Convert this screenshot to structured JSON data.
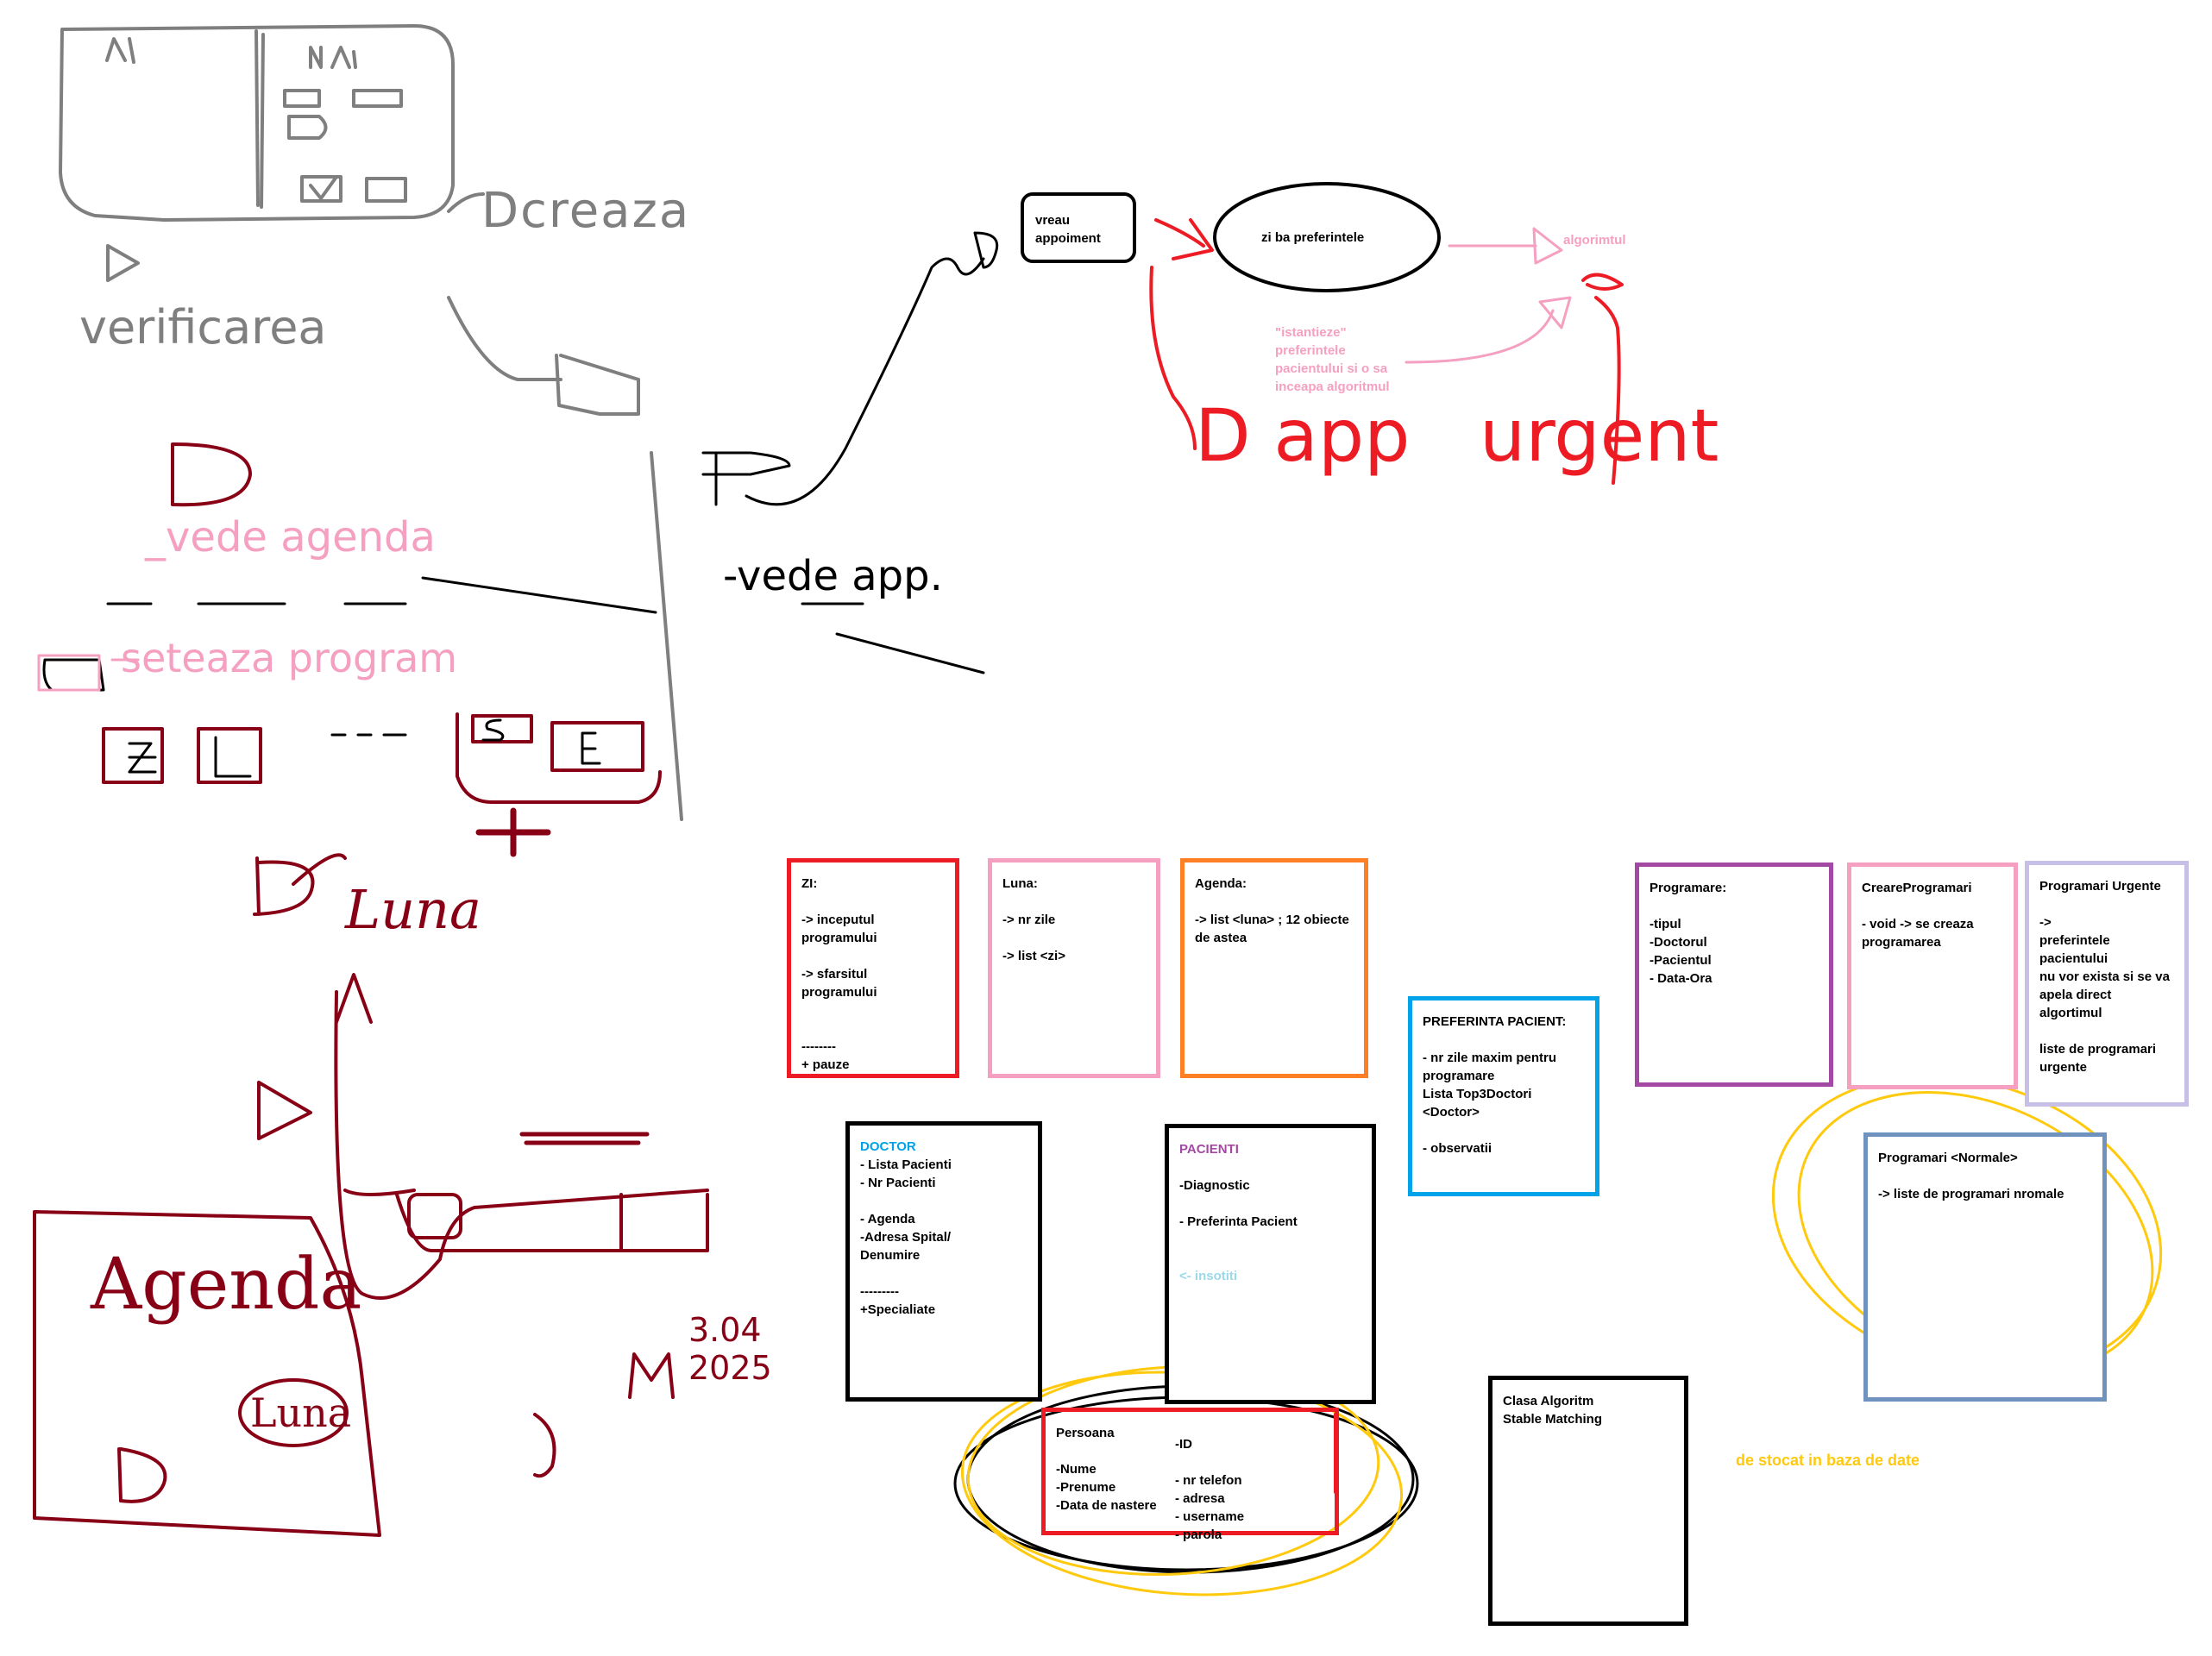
{
  "colors": {
    "grey_ink": "#7f7f7f",
    "darkred_ink": "#880015",
    "pink_ink": "#f5a0c0",
    "red_ink": "#ed1c24",
    "black_ink": "#000000",
    "yellow_ink": "#ffc90e",
    "blue_title": "#00a2e8",
    "purple_title": "#a349a4",
    "lightblue_text": "#99d9ea",
    "orange_text": "#ffc90e"
  },
  "flow": {
    "appointment": "vreau\nappoiment",
    "preferences": "zi ba preferintele",
    "algorithm": "algorimtul",
    "instantiate_note": "\"istantieze\"\npreferintele\npacientului si o sa\ninceapa algoritmul"
  },
  "sketch_text": {
    "creeaza": "Dcreaza",
    "verificarea": "verificarea",
    "vede_agenda": "_vede agenda",
    "seteaza": "seteaza program",
    "vede_app": "-vede app.",
    "d_app": "D app",
    "urgent": "urgent",
    "luna": "Luna",
    "agenda": "Agenda",
    "luna_box": "Luna",
    "date": "3.04\n2025"
  },
  "classes": [
    {
      "title": "ZI:",
      "lines": "-> inceputul\nprogramului\n\n-> sfarsitul programului\n\n\n--------\n+ pauze",
      "color": "#ed1c24"
    },
    {
      "title": "Luna:",
      "lines": "-> nr zile\n\n-> list <zi>",
      "color": "#f5a0c0"
    },
    {
      "title": "Agenda:",
      "lines": "-> list <luna> ; 12 obiecte\nde astea",
      "color": "#ff7f27"
    },
    {
      "title": "PREFERINTA PACIENT:",
      "lines": "- nr zile maxim pentru\nprogramare\nLista Top3Doctori <Doctor>\n\n- observatii",
      "color": "#00a2e8"
    },
    {
      "title": "Programare:",
      "lines": "-tipul\n-Doctorul\n-Pacientul\n- Data-Ora",
      "color": "#a349a4"
    },
    {
      "title": "CreareProgramari",
      "lines": "- void -> se creaza\nprogramarea",
      "color": "#f5a0c0"
    },
    {
      "title": "Programari Urgente",
      "lines": "->\npreferintele pacientului\nnu vor exista si se va\napela direct algortimul\n\n  liste de programari\n  urgente",
      "color": "#c8bfe7"
    },
    {
      "title": "DOCTOR",
      "lines": " - Lista Pacienti\n - Nr Pacienti\n\n- Agenda\n -Adresa Spital/\n Denumire\n\n---------\n+Specialiate",
      "color": "#000000"
    },
    {
      "title": "PACIENTI",
      "lines": "-Diagnostic\n\n- Preferinta Pacient",
      "note": "<- insotiti",
      "color": "#000000"
    },
    {
      "title": "Programari <Normale>",
      "lines": "-> liste   de programari nromale",
      "color": "#7092be"
    },
    {
      "title": "Persoana",
      "lines": "\n-Nume\n-Prenume\n-Data de nastere",
      "color": "#ed1c24"
    },
    {
      "title": "Clasa Algoritm\nStable Matching",
      "lines": "",
      "color": "#000000"
    }
  ],
  "persoana_right": "-ID\n\n - nr telefon\n- adresa\n - username\n- parola",
  "db_note": "de stocat in baza de date"
}
